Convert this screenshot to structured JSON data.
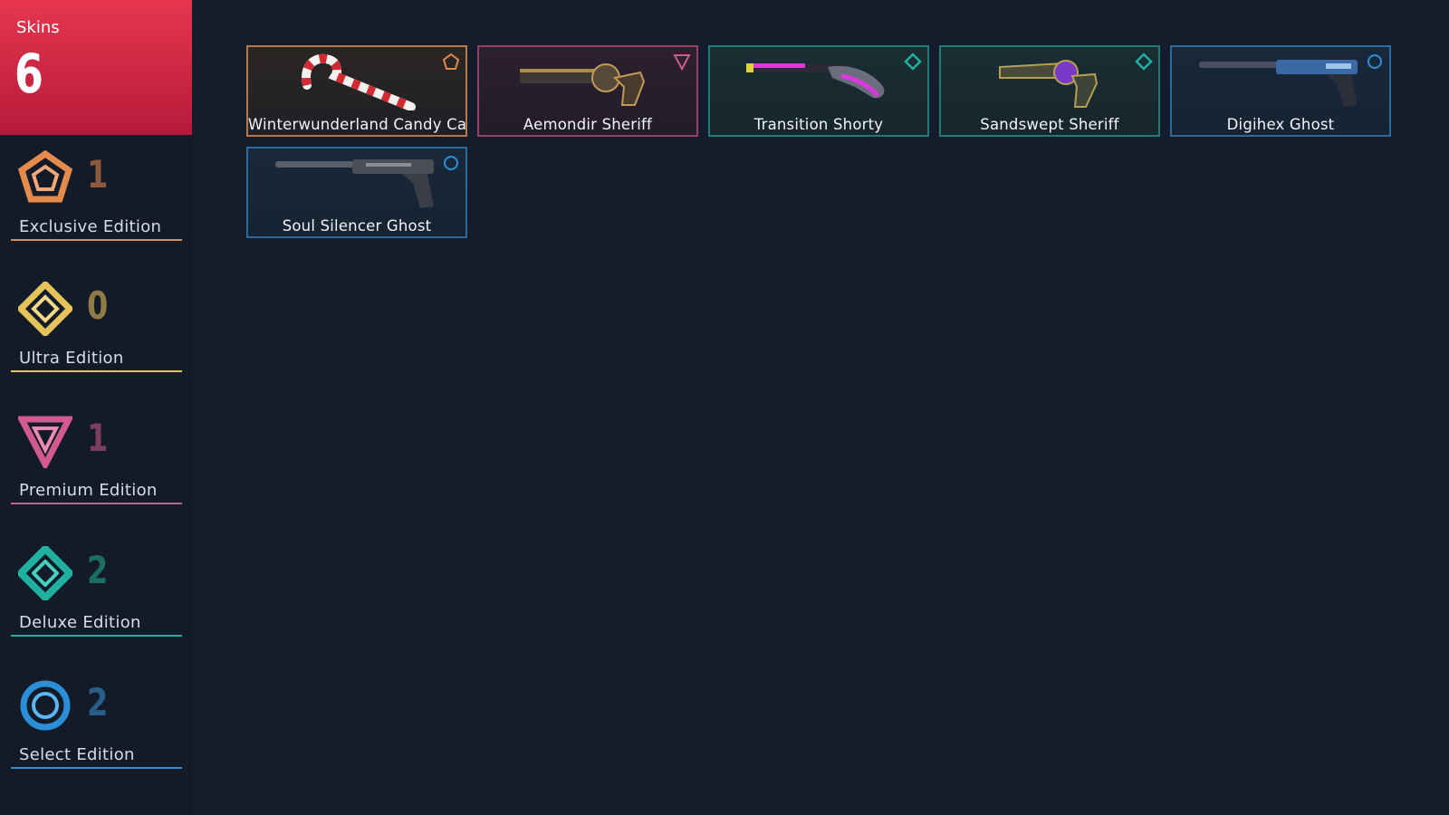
{
  "header": {
    "title": "Skins",
    "count": "6",
    "accent": "#e0334c"
  },
  "tiers": [
    {
      "label": "Exclusive Edition",
      "count": "1",
      "icon": "exclusive-edition-icon",
      "color": "#e38a4d",
      "count_color": "#8d5a3c"
    },
    {
      "label": "Ultra Edition",
      "count": "0",
      "icon": "ultra-edition-icon",
      "color": "#e6c35a",
      "count_color": "#8f7b45"
    },
    {
      "label": "Premium Edition",
      "count": "1",
      "icon": "premium-edition-icon",
      "color": "#d25a8f",
      "count_color": "#7d3d5e"
    },
    {
      "label": "Deluxe Edition",
      "count": "2",
      "icon": "deluxe-edition-icon",
      "color": "#1fb0a0",
      "count_color": "#1c6d66"
    },
    {
      "label": "Select Edition",
      "count": "2",
      "icon": "select-edition-icon",
      "color": "#2a8fd6",
      "count_color": "#2a5e8a"
    }
  ],
  "skins": [
    {
      "name": "Winterwunderland Candy Cane",
      "tier": "exclusive",
      "weapon_icon": "candy-cane-icon"
    },
    {
      "name": "Aemondir Sheriff",
      "tier": "premium",
      "weapon_icon": "sheriff-pistol-icon"
    },
    {
      "name": "Transition Shorty",
      "tier": "deluxe",
      "weapon_icon": "shorty-shotgun-icon"
    },
    {
      "name": "Sandswept Sheriff",
      "tier": "deluxe",
      "weapon_icon": "sheriff-pistol-icon"
    },
    {
      "name": "Digihex Ghost",
      "tier": "select",
      "weapon_icon": "ghost-pistol-icon"
    },
    {
      "name": "Soul Silencer Ghost",
      "tier": "select",
      "weapon_icon": "ghost-pistol-icon"
    }
  ]
}
